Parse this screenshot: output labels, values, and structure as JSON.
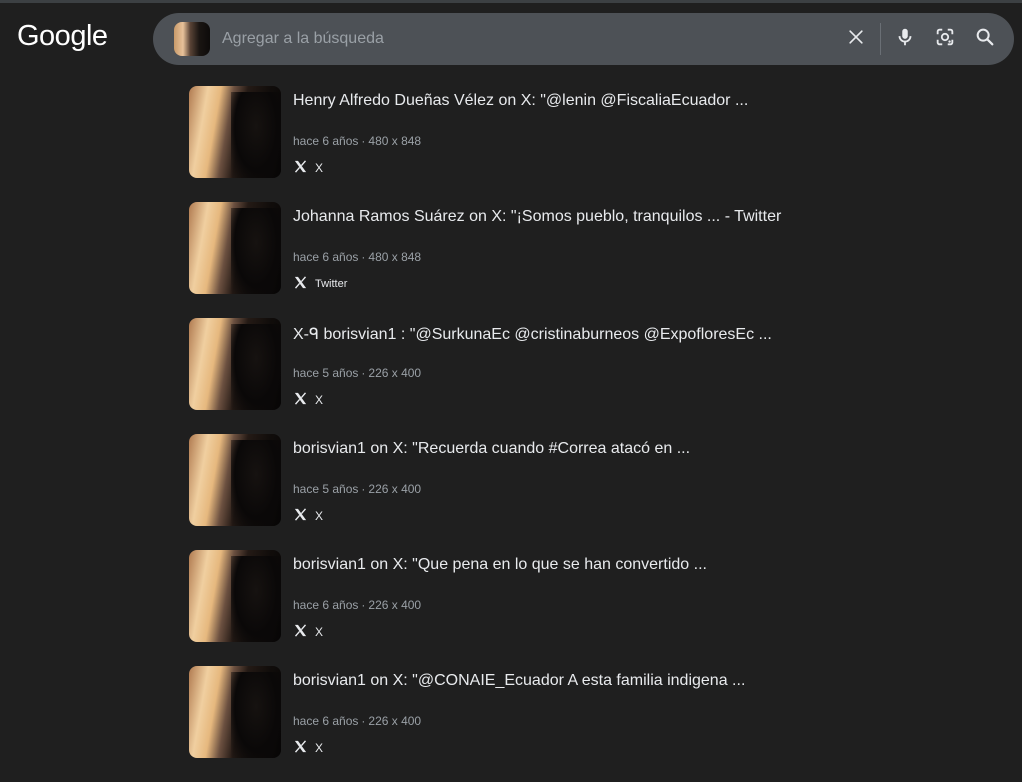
{
  "logo": "Google",
  "search": {
    "placeholder": "Agregar a la búsqueda"
  },
  "results": [
    {
      "title": "Henry Alfredo Dueñas Vélez on X: \"@lenin @FiscaliaEcuador ...",
      "age": "hace 6 años",
      "dimensions": "480 x 848",
      "source": "X"
    },
    {
      "title": "Johanna Ramos Suárez on X: \"¡Somos pueblo, tranquilos ... - Twitter",
      "age": "hace 6 años",
      "dimensions": "480 x 848",
      "source": "Twitter"
    },
    {
      "title": "X-ᑫ borisvian1 : \"@SurkunaEc @cristinaburneos @ExpofloresEc ...",
      "age": "hace 5 años",
      "dimensions": "226 x 400",
      "source": "X"
    },
    {
      "title": "borisvian1 on X: \"Recuerda cuando #Correa atacó en ...",
      "age": "hace 5 años",
      "dimensions": "226 x 400",
      "source": "X"
    },
    {
      "title": "borisvian1 on X: \"Que pena en lo que se han convertido ...",
      "age": "hace 6 años",
      "dimensions": "226 x 400",
      "source": "X"
    },
    {
      "title": "borisvian1 on X: \"@CONAIE_Ecuador A esta familia indigena ...",
      "age": "hace 6 años",
      "dimensions": "226 x 400",
      "source": "X"
    }
  ],
  "meta_separator": "·",
  "icons": {
    "clear": "close-icon",
    "voice": "microphone-icon",
    "lens": "google-lens-icon",
    "search": "search-icon",
    "source": "x-logo-icon"
  },
  "colors": {
    "background": "#1f1f1f",
    "searchbar": "#4d5156",
    "text": "#e8eaed",
    "muted": "#9aa0a6"
  }
}
